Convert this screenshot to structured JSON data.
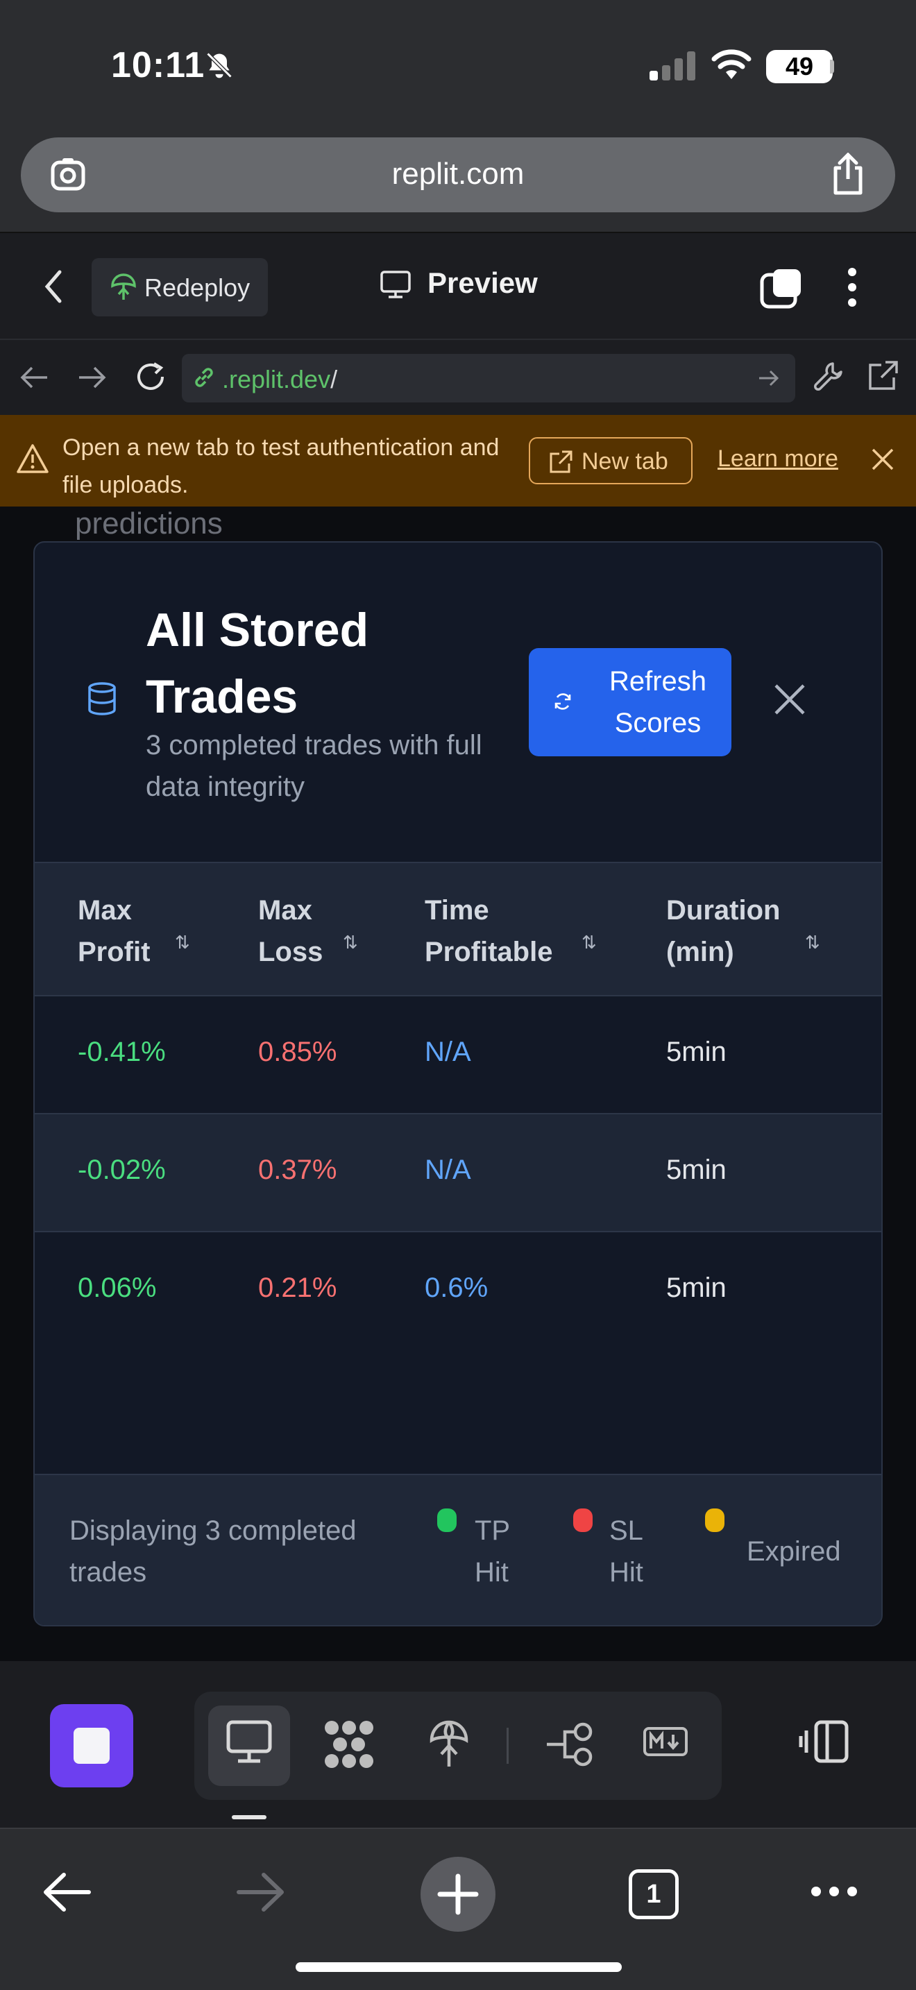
{
  "status_bar": {
    "time": "10:11",
    "battery": "49"
  },
  "safari": {
    "url": "replit.com",
    "tab_count": "1"
  },
  "replit": {
    "redeploy_label": "Redeploy",
    "preview_label": "Preview",
    "address_host": ".replit.dev",
    "address_path": "/"
  },
  "banner": {
    "message": "Open a new tab to test authentication and file uploads.",
    "new_tab_label": "New tab",
    "learn_more_label": "Learn more"
  },
  "page": {
    "background_heading": "predictions"
  },
  "modal": {
    "title": "All Stored Trades",
    "subtitle": "3 completed trades with full data integrity",
    "refresh_label": "Refresh Scores",
    "columns": [
      "Max Profit",
      "Max Loss",
      "Time Profitable",
      "Duration (min)"
    ],
    "rows": [
      {
        "max_profit": "-0.41%",
        "max_loss": "0.85%",
        "time_profitable": "N/A",
        "duration": "5min"
      },
      {
        "max_profit": "-0.02%",
        "max_loss": "0.37%",
        "time_profitable": "N/A",
        "duration": "5min"
      },
      {
        "max_profit": "0.06%",
        "max_loss": "0.21%",
        "time_profitable": "0.6%",
        "duration": "5min"
      }
    ],
    "footer_text": "Displaying 3 completed trades",
    "legend": [
      {
        "label": "TP Hit",
        "color": "#22c55e"
      },
      {
        "label": "SL Hit",
        "color": "#ef4444"
      },
      {
        "label": "Expired",
        "color": "#eab308"
      }
    ]
  },
  "colors": {
    "accent": "#2563eb",
    "stop_button": "#6d3ff0",
    "warning_banner": "#563300"
  }
}
